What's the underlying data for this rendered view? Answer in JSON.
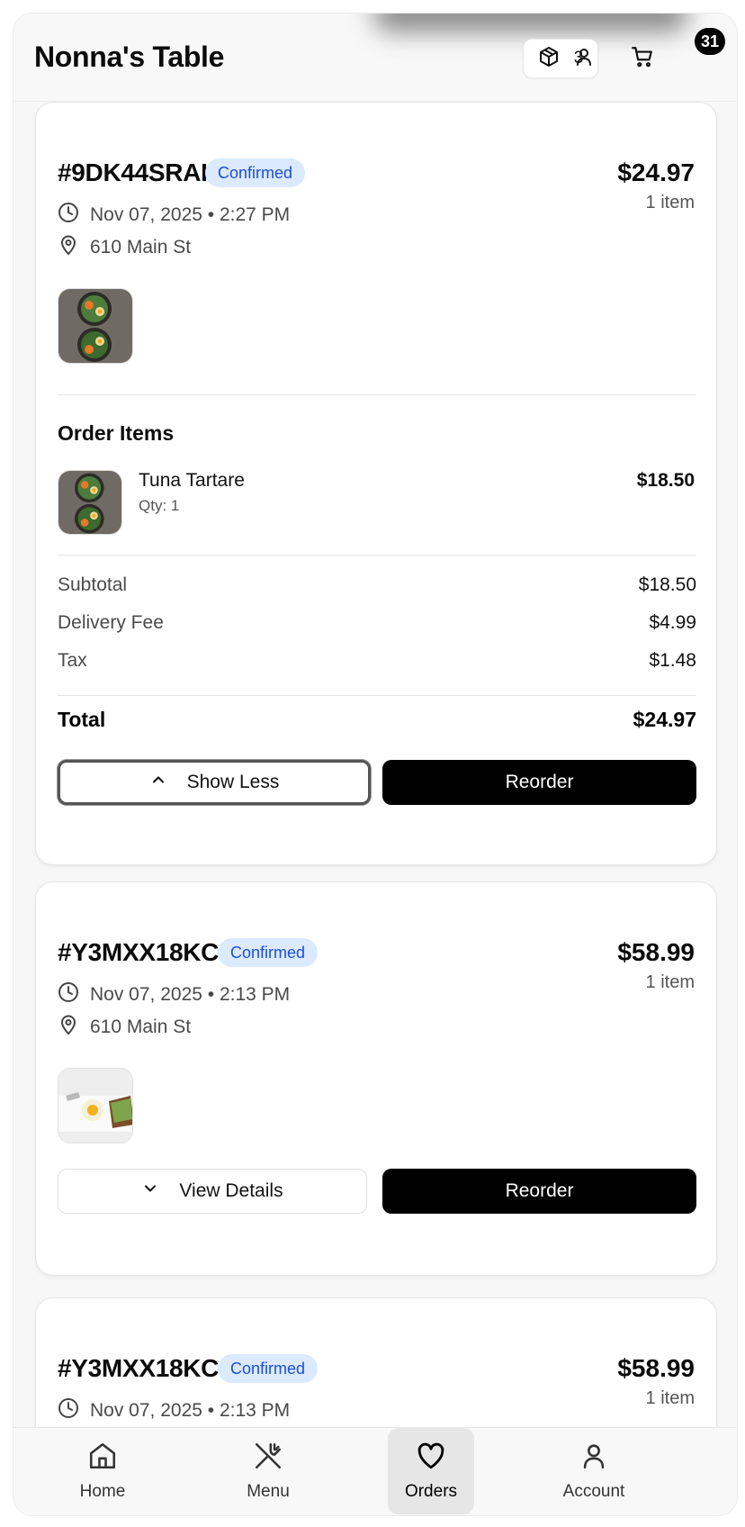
{
  "app": {
    "title": "Nonna's Table",
    "orders_count": "3",
    "cart_count": "31"
  },
  "icons": {
    "orders": "package-icon",
    "account": "user-icon",
    "cart": "cart-icon",
    "clock": "clock-icon",
    "location": "map-pin-icon",
    "chevron_up": "chevron-up-icon",
    "chevron_down": "chevron-down-icon"
  },
  "colors": {
    "badge_bg": "#dbeafe",
    "badge_text": "#1d4ed8",
    "primary": "#000000"
  },
  "orders": [
    {
      "id": "#9DK44SRAI",
      "status": "Confirmed",
      "total": "$24.97",
      "item_count": "1 item",
      "date": "Nov 07, 2025 • 2:27 PM",
      "address": "610 Main St",
      "items_title": "Order Items",
      "items": [
        {
          "name": "Tuna Tartare",
          "qty": "Qty: 1",
          "price": "$18.50"
        }
      ],
      "summary": {
        "subtotal_label": "Subtotal",
        "subtotal": "$18.50",
        "delivery_label": "Delivery Fee",
        "delivery": "$4.99",
        "tax_label": "Tax",
        "tax": "$1.48",
        "total_label": "Total",
        "total": "$24.97"
      },
      "toggle_label": "Show Less",
      "reorder_label": "Reorder"
    },
    {
      "id": "#Y3MXX18KC",
      "status": "Confirmed",
      "total": "$58.99",
      "item_count": "1 item",
      "date": "Nov 07, 2025 • 2:13 PM",
      "address": "610 Main St",
      "toggle_label": "View Details",
      "reorder_label": "Reorder"
    },
    {
      "id": "#Y3MXX18KC",
      "status": "Confirmed",
      "total": "$58.99",
      "item_count": "1 item",
      "date": "Nov 07, 2025 • 2:13 PM"
    }
  ],
  "nav": [
    {
      "label": "Home",
      "icon": "home-icon"
    },
    {
      "label": "Menu",
      "icon": "utensils-icon"
    },
    {
      "label": "Orders",
      "icon": "heart-icon",
      "active": true
    },
    {
      "label": "Account",
      "icon": "user-icon"
    }
  ]
}
